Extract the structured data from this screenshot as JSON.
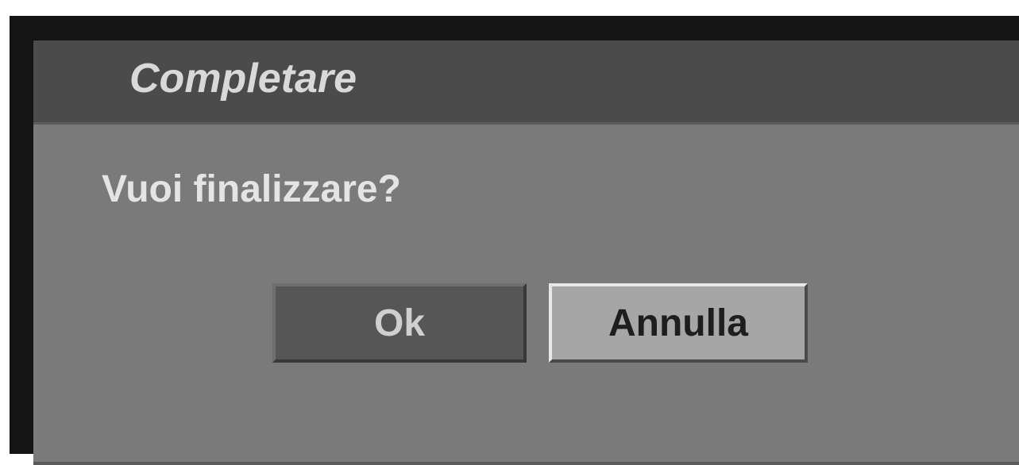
{
  "dialog": {
    "title": "Completare",
    "message": "Vuoi finalizzare?",
    "buttons": {
      "ok_label": "Ok",
      "cancel_label": "Annulla"
    },
    "selected_button": "cancel"
  },
  "colors": {
    "title_bar": "#4b4b4b",
    "dialog_body": "#7a7a7a",
    "ok_button": "#565656",
    "cancel_button_selected": "#a6a6a6"
  }
}
